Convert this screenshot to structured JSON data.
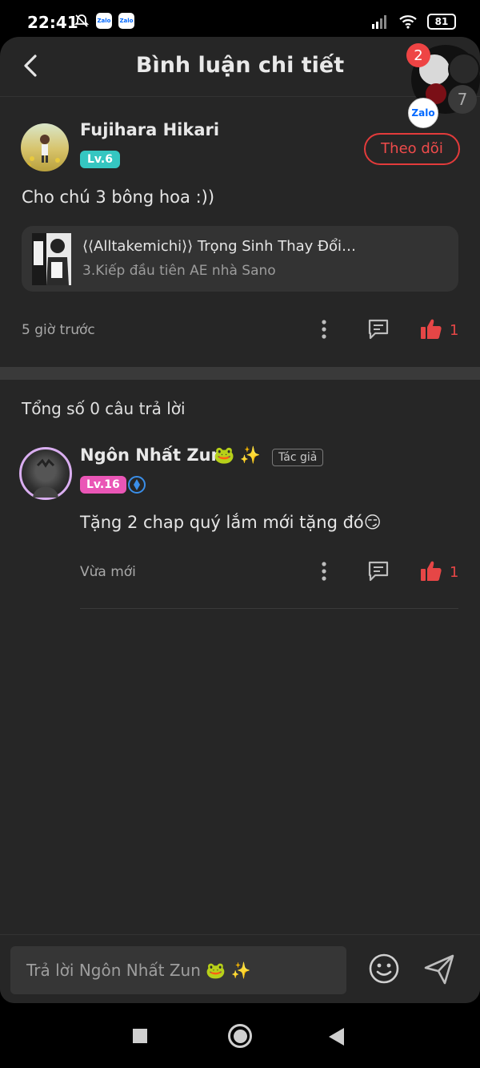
{
  "status_bar": {
    "time": "22:41",
    "battery": "81",
    "zalo_label": "Zalo"
  },
  "header": {
    "title": "Bình luận chi tiết"
  },
  "floating_bubble": {
    "badge": "2",
    "count": "7",
    "zalo_label": "Zalo"
  },
  "comment": {
    "author": "Fujihara Hikari",
    "level": "Lv.6",
    "follow_label": "Theo dõi",
    "text": "Cho chú 3 bông hoa :))",
    "story_title": "⟨⟨Alltakemichi⟩⟩ Trọng Sinh Thay Đổi…",
    "story_chapter": "3.Kiếp đầu tiên AE nhà Sano",
    "time": "5 giờ trước",
    "likes": "1"
  },
  "replies_summary": "Tổng số 0 câu trả lời",
  "reply": {
    "author": "Ngôn Nhất Zun",
    "author_emoji": "🐸 ✨",
    "author_tag": "Tác giả",
    "level": "Lv.16",
    "text": "Tặng 2 chap quý lắm mới tặng đó😏",
    "time": "Vừa mới",
    "likes": "1"
  },
  "input": {
    "placeholder": "Trả lời Ngôn Nhất Zun 🐸 ✨"
  },
  "icons": [
    "back-arrow-icon",
    "more-vertical-icon",
    "reply-bubble-icon",
    "thumbs-up-icon",
    "emoji-icon",
    "send-icon",
    "verified-icon"
  ],
  "colors": {
    "accent_red": "#e64646",
    "level_teal": "#35c6c1",
    "level_pink": "#ea56b6",
    "background": "#262626"
  }
}
